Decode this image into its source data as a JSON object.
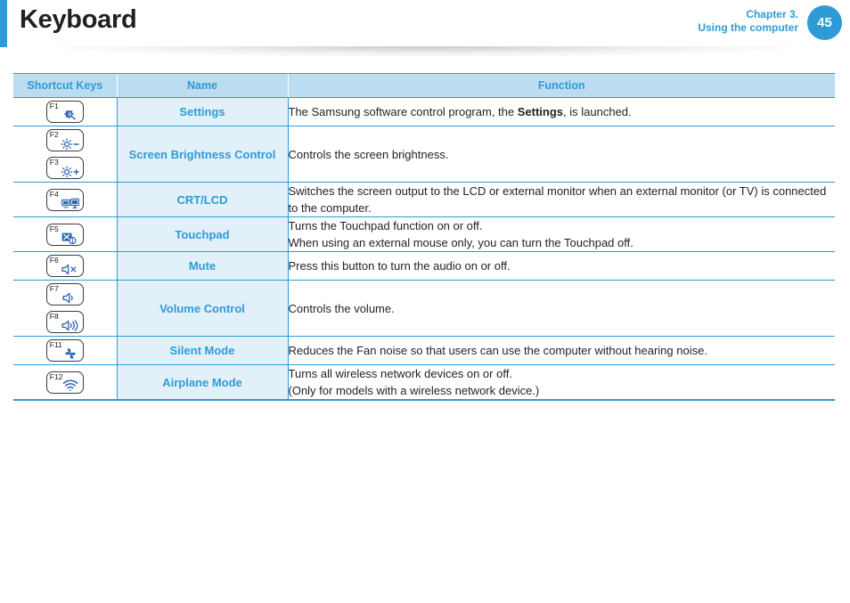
{
  "header": {
    "title": "Keyboard",
    "chapter_line1": "Chapter 3.",
    "chapter_line2": "Using the computer",
    "page_number": "45",
    "accent_color": "#2e9bd6"
  },
  "table": {
    "columns": [
      "Shortcut Keys",
      "Name",
      "Function"
    ],
    "rows": [
      {
        "keys": [
          {
            "fn": "F1",
            "icon": "settings-gear-icon"
          }
        ],
        "name": "Settings",
        "function_html": "The Samsung software control program, the <b>Settings</b>, is launched."
      },
      {
        "keys": [
          {
            "fn": "F2",
            "icon": "brightness-down-icon"
          },
          {
            "fn": "F3",
            "icon": "brightness-up-icon"
          }
        ],
        "name": "Screen Brightness Control",
        "function_html": "Controls the screen brightness."
      },
      {
        "keys": [
          {
            "fn": "F4",
            "icon": "external-monitor-icon"
          }
        ],
        "name": "CRT/LCD",
        "function_html": "Switches the screen output to the LCD or external monitor when an external monitor (or TV) is connected to the computer."
      },
      {
        "keys": [
          {
            "fn": "F5",
            "icon": "touchpad-icon"
          }
        ],
        "name": "Touchpad",
        "function_html": "Turns the Touchpad function on or off.<br>When using an external mouse only, you can turn the Touchpad off."
      },
      {
        "keys": [
          {
            "fn": "F6",
            "icon": "mute-speaker-icon"
          }
        ],
        "name": "Mute",
        "function_html": "Press this button to turn the audio on or off."
      },
      {
        "keys": [
          {
            "fn": "F7",
            "icon": "volume-down-icon"
          },
          {
            "fn": "F8",
            "icon": "volume-up-icon"
          }
        ],
        "name": "Volume Control",
        "function_html": "Controls the volume."
      },
      {
        "keys": [
          {
            "fn": "F11",
            "icon": "fan-icon"
          }
        ],
        "name": "Silent Mode",
        "function_html": "Reduces the Fan noise so that users can use the computer without hearing noise."
      },
      {
        "keys": [
          {
            "fn": "F12",
            "icon": "wifi-icon"
          }
        ],
        "name": "Airplane Mode",
        "function_html": "Turns all wireless network devices on or off.<br>(Only for models with a wireless network device.)"
      }
    ]
  }
}
